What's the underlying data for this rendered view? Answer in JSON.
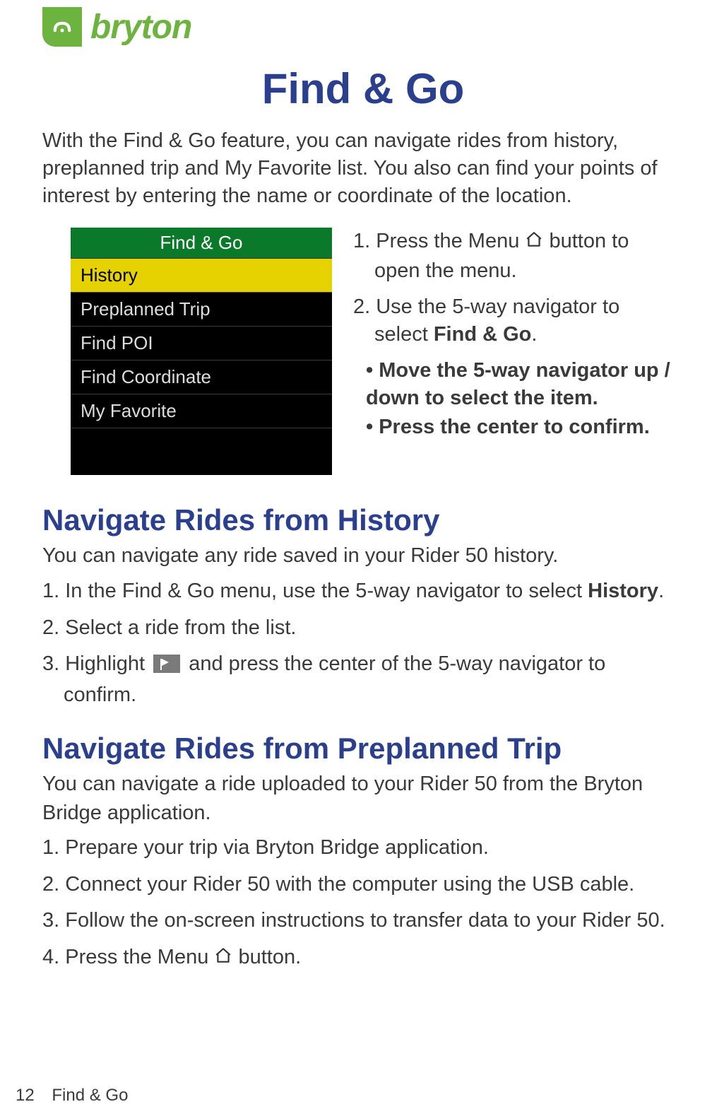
{
  "brand": {
    "name": "bryton"
  },
  "page_title": "Find & Go",
  "intro": "With the Find & Go feature, you can navigate rides from history, preplanned trip and My Favorite list. You also can find your points of interest by entering the name or coordinate of the location.",
  "device_menu": {
    "title": "Find & Go",
    "items": [
      "History",
      "Preplanned Trip",
      "Find POI",
      "Find Coordinate",
      "My Favorite"
    ],
    "selected_index": 0
  },
  "steps_top": {
    "s1_a": "1. Press the Menu ",
    "s1_b": " button to",
    "s1_c": "open the menu.",
    "s2_a": "2. Use the 5-way navigator to",
    "s2_b": "select ",
    "s2_bold": "Find & Go",
    "s2_c": ".",
    "bullet1": "• Move the 5-way navigator up / down to select the item.",
    "bullet2": "• Press the center to confirm."
  },
  "section_history": {
    "heading": "Navigate Rides from History",
    "intro": "You can navigate any ride saved in your Rider 50 history.",
    "s1_a": "1. In the Find & Go menu, use the 5-way navigator to select ",
    "s1_bold": "History",
    "s1_b": ".",
    "s2": "2. Select a ride from the list.",
    "s3_a": "3. Highlight ",
    "s3_b": " and press the center of the 5-way navigator to",
    "s3_c": "confirm."
  },
  "section_preplanned": {
    "heading": "Navigate Rides from Preplanned Trip",
    "intro": "You can navigate a ride uploaded to your Rider 50 from the Bryton Bridge application.",
    "s1": "1. Prepare your trip via Bryton Bridge application.",
    "s2": "2. Connect your Rider 50 with the computer using the USB cable.",
    "s3": "3. Follow the on-screen instructions to transfer data to your Rider 50.",
    "s4_a": "4. Press the Menu ",
    "s4_b": " button."
  },
  "footer": {
    "page_number": "12",
    "section": "Find & Go"
  }
}
